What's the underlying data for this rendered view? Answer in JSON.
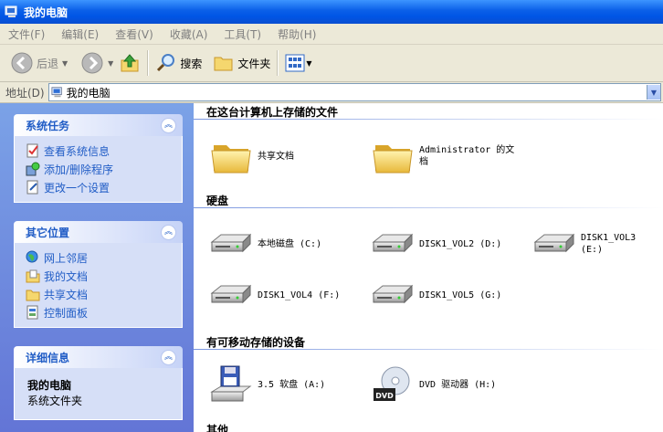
{
  "window": {
    "title": "我的电脑"
  },
  "menu": [
    "文件(F)",
    "编辑(E)",
    "查看(V)",
    "收藏(A)",
    "工具(T)",
    "帮助(H)"
  ],
  "toolbar": {
    "back": "后退",
    "search": "搜索",
    "folders": "文件夹"
  },
  "address": {
    "label": "地址(D)",
    "value": "我的电脑"
  },
  "left": {
    "system_tasks": {
      "title": "系统任务",
      "items": [
        "查看系统信息",
        "添加/删除程序",
        "更改一个设置"
      ]
    },
    "other_places": {
      "title": "其它位置",
      "items": [
        "网上邻居",
        "我的文档",
        "共享文档",
        "控制面板"
      ]
    },
    "details": {
      "title": "详细信息",
      "name": "我的电脑",
      "type": "系统文件夹"
    }
  },
  "main": {
    "files_group": {
      "title": "在这台计算机上存储的文件",
      "items": [
        "共享文档",
        "Administrator 的文档"
      ]
    },
    "disks_group": {
      "title": "硬盘",
      "items": [
        "本地磁盘 (C:)",
        "DISK1_VOL2 (D:)",
        "DISK1_VOL3 (E:)",
        "DISK1_VOL4 (F:)",
        "DISK1_VOL5 (G:)"
      ]
    },
    "removable_group": {
      "title": "有可移动存储的设备",
      "items": [
        "3.5 软盘 (A:)",
        "DVD 驱动器 (H:)"
      ]
    },
    "other_group": {
      "title": "其他"
    }
  }
}
